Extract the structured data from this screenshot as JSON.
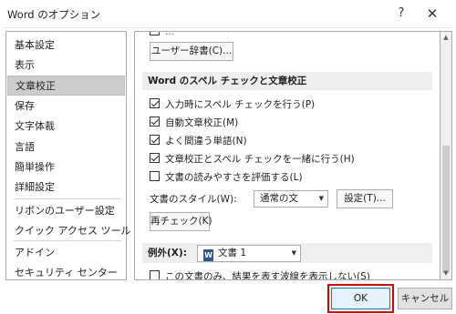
{
  "window": {
    "title": "Word のオプション",
    "help_label": "?",
    "close_label": "✕"
  },
  "sidebar": {
    "items": [
      {
        "label": "基本設定"
      },
      {
        "label": "表示"
      },
      {
        "label": "文章校正",
        "selected": true
      },
      {
        "label": "保存"
      },
      {
        "label": "文字体裁"
      },
      {
        "label": "言語"
      },
      {
        "label": "簡単操作"
      },
      {
        "label": "詳細設定"
      },
      {
        "label": "リボンのユーザー設定"
      },
      {
        "label": "クイック アクセス ツール バー"
      },
      {
        "label": "アドイン"
      },
      {
        "label": "セキュリティ センター"
      }
    ]
  },
  "content": {
    "top_partial_text": "...",
    "custom_dict_button": "ユーザー辞書(C)...",
    "spelling_section_title": "Word のスペル チェックと文章校正",
    "spelling_options": [
      {
        "label": "入力時にスペル チェックを行う(P)",
        "checked": true
      },
      {
        "label": "自動文章校正(M)",
        "checked": true
      },
      {
        "label": "よく間違う単語(N)",
        "checked": true
      },
      {
        "label": "文章校正とスペル チェックを一緒に行う(H)",
        "checked": true
      },
      {
        "label": "文書の読みやすさを評価する(L)",
        "checked": false
      }
    ],
    "writing_style_label": "文書のスタイル(W):",
    "writing_style_value": "通常の文",
    "settings_button": "設定(T)...",
    "recheck_button": "再チェック(K)",
    "exceptions_label": "例外(X):",
    "exceptions_doc": "文書 1",
    "doc_icon_glyph": "W",
    "hide_errors_option": {
      "label": "この文書のみ、結果を表す波線を表示しない(S)",
      "checked": false
    }
  },
  "footer": {
    "ok_label": "OK",
    "cancel_label": "キャンセル"
  },
  "colors": {
    "highlight_outline": "#e00000",
    "ok_border": "#0078d7"
  }
}
